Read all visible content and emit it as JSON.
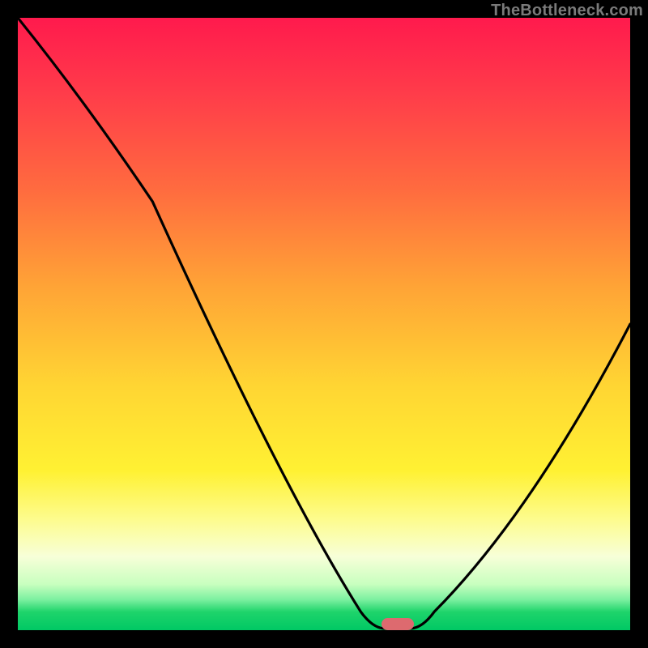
{
  "watermark": "TheBottleneck.com",
  "chart_data": {
    "type": "line",
    "title": "",
    "xlabel": "",
    "ylabel": "",
    "xlim": [
      0,
      100
    ],
    "ylim": [
      0,
      100
    ],
    "grid": false,
    "legend": false,
    "series": [
      {
        "name": "bottleneck-curve",
        "x": [
          0,
          22,
          56,
          60,
          64,
          68,
          100
        ],
        "y": [
          100,
          70,
          3,
          0,
          0,
          3,
          50
        ]
      }
    ],
    "marker": {
      "x": 62,
      "y": 0,
      "color": "#dd6a6f"
    },
    "background_gradient": {
      "top": "#ff1a4d",
      "mid_upper": "#ffa436",
      "mid": "#fff133",
      "mid_lower": "#f7ffd8",
      "bottom": "#00c864"
    }
  },
  "colors": {
    "frame": "#000000",
    "curve": "#000000",
    "marker": "#dd6a6f",
    "watermark": "#7a7a7a"
  }
}
